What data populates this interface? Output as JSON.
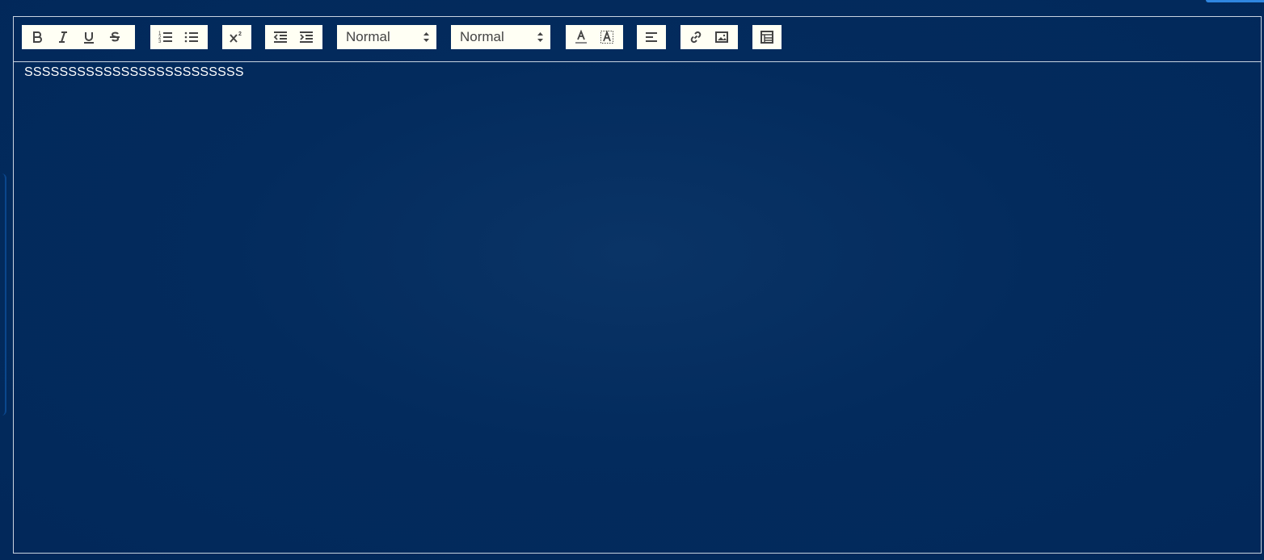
{
  "editor": {
    "content_text": "SSSSSSSSSSSSSSSSSSSSSSSSS"
  },
  "toolbar": {
    "header_select_value": "Normal",
    "size_select_value": "Normal",
    "icons": [
      "bold-icon",
      "italic-icon",
      "underline-icon",
      "strike-icon",
      "ordered-list-icon",
      "bullet-list-icon",
      "superscript-icon",
      "outdent-icon",
      "indent-icon",
      "text-color-icon",
      "background-color-icon",
      "align-left-icon",
      "link-icon",
      "image-icon",
      "table-icon"
    ]
  },
  "colors": {
    "background": "#02285a",
    "toolbar_button_bg": "#fffff4",
    "icon": "#444444",
    "border": "#c9d3e0",
    "accent": "#2f86e0"
  }
}
